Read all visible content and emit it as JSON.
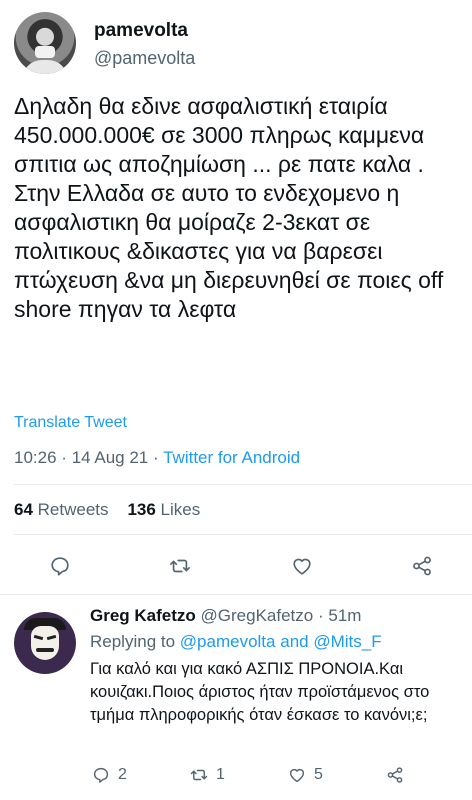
{
  "tweet": {
    "display_name": "pamevolta",
    "handle": "@pamevolta",
    "text": "Δηλαδη θα εδινε ασφαλιστική εταιρία 450.000.000€ σε 3000 πληρως καμμενα σπιτια ως αποζημίωση ... ρε πατε καλα . Στην Ελλαδα σε αυτο το ενδεχομενο η ασφαλιστικη θα μοίραζε 2-3εκατ σε πολιτικους &δικαστες για να βαρεσει πτώχευση &να μη διερευνηθεί σε ποιες off shore πηγαν τα λεφτα",
    "translate_label": "Translate Tweet",
    "time": "10:26",
    "date": "14 Aug 21",
    "separator": "·",
    "client": "Twitter for Android",
    "retweets_count": "64",
    "retweets_label": "Retweets",
    "likes_count": "136",
    "likes_label": "Likes",
    "actions": [
      "reply-icon",
      "retweet-icon",
      "like-icon",
      "share-icon"
    ]
  },
  "reply": {
    "display_name": "Greg Kafetzo",
    "handle": "@GregKafetzo",
    "age": "51m",
    "separator": "·",
    "replying_prefix": "Replying to",
    "mention1": "@pamevolta",
    "and": "and",
    "mention2": "@Mits_F",
    "text": "Για καλό και για κακό ΑΣΠΙΣ ΠΡΟΝΟΙΑ.Και κουιζακι.Ποιος άριστος ήταν προϊστάμενος στο τμήμα πληροφορικής όταν έσκασε το κανόνι;ε;",
    "reply_count": "2",
    "retweet_count": "1",
    "like_count": "5"
  },
  "colors": {
    "accent": "#1d9bf0",
    "secondary_text": "#536471",
    "primary_text": "#0f1419",
    "divider": "#e6ecf0"
  }
}
